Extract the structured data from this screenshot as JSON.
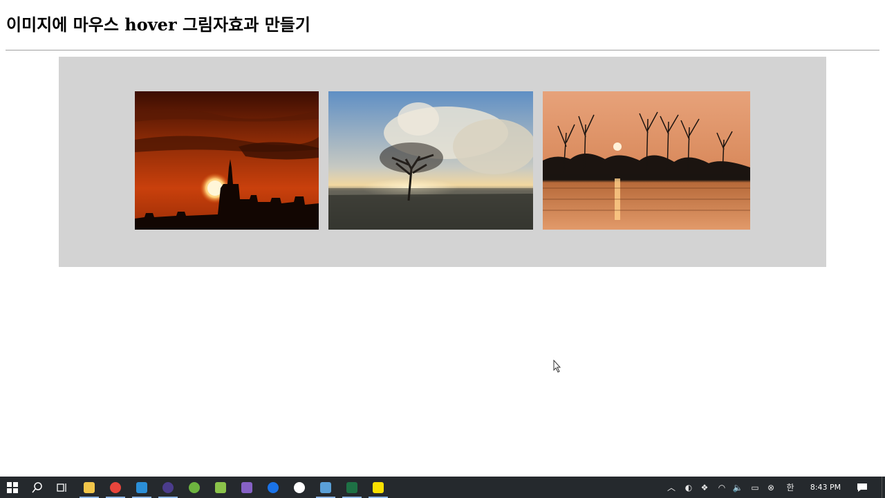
{
  "page": {
    "title": "이미지에 마우스 hover 그림자효과 만들기"
  },
  "gallery": {
    "background": "#d3d3d3",
    "images": [
      {
        "subject": "sunset-church-silhouette",
        "palette": [
          "#3b0f03",
          "#c9400c",
          "#ffe9c0"
        ]
      },
      {
        "subject": "lone-tree-cloudy-sky",
        "palette": [
          "#6f9ac8",
          "#e9d9b8",
          "#3a3a36"
        ]
      },
      {
        "subject": "sunset-lake-trees-reflection",
        "palette": [
          "#e3a37a",
          "#1a1410",
          "#c8703a"
        ]
      }
    ]
  },
  "taskbar": {
    "background": "#25292d",
    "apps": [
      {
        "name": "start-icon"
      },
      {
        "name": "search-icon"
      },
      {
        "name": "task-view-icon"
      },
      {
        "name": "file-explorer-icon",
        "color": "#f2c64a",
        "active": true
      },
      {
        "name": "chrome-icon",
        "color": "#e8453c",
        "active": true
      },
      {
        "name": "vscode-icon",
        "color": "#2b8fd8",
        "active": true
      },
      {
        "name": "eclipse-icon",
        "color": "#4b3c8c",
        "active": true
      },
      {
        "name": "spring-icon",
        "color": "#6db33f"
      },
      {
        "name": "notepad-plus-icon",
        "color": "#8bc34a"
      },
      {
        "name": "visual-studio-icon",
        "color": "#8661c5"
      },
      {
        "name": "maps-icon",
        "color": "#1a73e8"
      },
      {
        "name": "app-icon",
        "color": "#ffffff"
      },
      {
        "name": "writer-icon",
        "color": "#5aa0d8",
        "active": true
      },
      {
        "name": "excel-icon",
        "color": "#1e7145",
        "active": true
      },
      {
        "name": "kakaotalk-icon",
        "color": "#f9e000",
        "active": true
      }
    ],
    "tray": {
      "input_method": "한",
      "clock": "8:43 PM"
    }
  }
}
